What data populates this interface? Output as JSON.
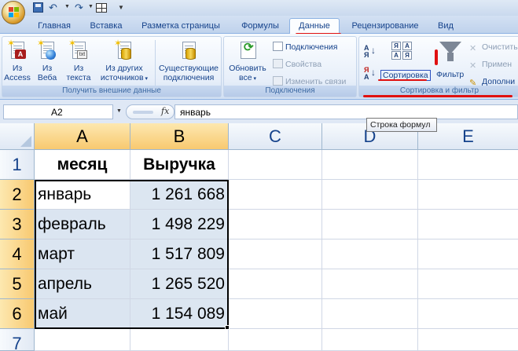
{
  "quick_access": {
    "undo_icon": "undo-icon",
    "redo_icon": "redo-icon",
    "save_icon": "save-icon"
  },
  "tabs": [
    {
      "label": "Главная"
    },
    {
      "label": "Вставка"
    },
    {
      "label": "Разметка страницы"
    },
    {
      "label": "Формулы"
    },
    {
      "label": "Данные",
      "active": true
    },
    {
      "label": "Рецензирование"
    },
    {
      "label": "Вид"
    }
  ],
  "ribbon": {
    "external_data": {
      "label": "Получить внешние данные",
      "buttons": [
        {
          "line1": "Из",
          "line2": "Access"
        },
        {
          "line1": "Из",
          "line2": "Веба"
        },
        {
          "line1": "Из",
          "line2": "текста"
        },
        {
          "line1": "Из других",
          "line2": "источников"
        }
      ],
      "existing": {
        "line1": "Существующие",
        "line2": "подключения"
      }
    },
    "connections": {
      "label": "Подключения",
      "refresh": {
        "line1": "Обновить",
        "line2": "все"
      },
      "items": [
        "Подключения",
        "Свойства",
        "Изменить связи"
      ]
    },
    "sort_filter": {
      "label": "Сортировка и фильтр",
      "az": "А",
      "za": "Я",
      "sort": "Сортировка",
      "filter": "Фильтр",
      "items": [
        "Очистить",
        "Примен",
        "Дополни"
      ]
    }
  },
  "formula_bar": {
    "name_box": "A2",
    "fx": "fx",
    "value": "январь",
    "tooltip": "Строка формул"
  },
  "sheet": {
    "columns": [
      "A",
      "B",
      "C",
      "D",
      "E"
    ],
    "rows": [
      "1",
      "2",
      "3",
      "4",
      "5",
      "6",
      "7"
    ],
    "header": {
      "a": "месяц",
      "b": "Выручка"
    },
    "data": [
      {
        "month": "январь",
        "revenue": "1 261 668"
      },
      {
        "month": "февраль",
        "revenue": "1 498 229"
      },
      {
        "month": "март",
        "revenue": "1 517 809"
      },
      {
        "month": "апрель",
        "revenue": "1 265 520"
      },
      {
        "month": "май",
        "revenue": "1 154 089"
      }
    ]
  },
  "colors": {
    "accent_red": "#e01010",
    "selection_highlight": "#f8c970",
    "range_fill": "#dce6f1"
  }
}
